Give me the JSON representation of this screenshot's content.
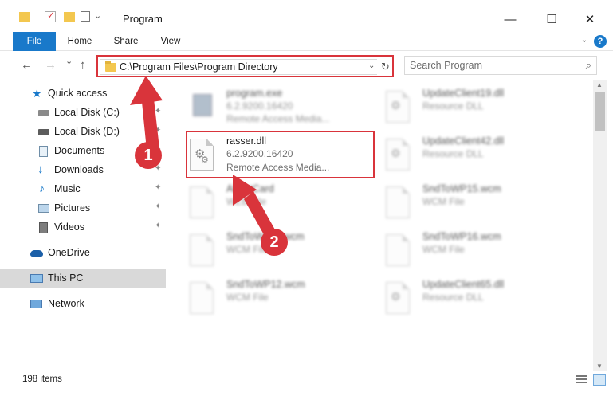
{
  "window": {
    "title": "Program",
    "minimize_glyph": "—",
    "maximize_glyph": "☐",
    "close_glyph": "✕"
  },
  "ribbon": {
    "tabs": [
      "File",
      "Home",
      "Share",
      "View"
    ],
    "help_glyph": "?",
    "collapse_glyph": "⌄"
  },
  "nav": {
    "back_glyph": "←",
    "forward_glyph": "→",
    "recent_glyph": "⌄",
    "up_glyph": "↑"
  },
  "address": {
    "path": "C:\\Program Files\\Program Directory",
    "dropdown_glyph": "⌄",
    "refresh_glyph": "↻"
  },
  "search": {
    "placeholder": "Search Program",
    "icon_glyph": "⌕"
  },
  "sidebar": {
    "items": [
      {
        "label": "Quick access",
        "icon": "star-icon",
        "pinned": false
      },
      {
        "label": "Local Disk (C:)",
        "icon": "drive-icon",
        "pinned": true
      },
      {
        "label": "Local Disk (D:)",
        "icon": "drive-icon",
        "pinned": true
      },
      {
        "label": "Documents",
        "icon": "documents-icon",
        "pinned": true
      },
      {
        "label": "Downloads",
        "icon": "download-icon",
        "pinned": true
      },
      {
        "label": "Music",
        "icon": "music-icon",
        "pinned": true
      },
      {
        "label": "Pictures",
        "icon": "pictures-icon",
        "pinned": true
      },
      {
        "label": "Videos",
        "icon": "videos-icon",
        "pinned": true
      },
      {
        "label": "OneDrive",
        "icon": "cloud-icon",
        "pinned": false
      },
      {
        "label": "This PC",
        "icon": "computer-icon",
        "pinned": false,
        "selected": true
      },
      {
        "label": "Network",
        "icon": "network-icon",
        "pinned": false
      }
    ],
    "pin_glyph": "📌"
  },
  "files": {
    "left": [
      {
        "name": "program.exe",
        "line1": "6.2.9200.16420",
        "line2": "Remote Access Media...",
        "icon": "exe-icon",
        "blurred": true
      },
      {
        "name": "rasser.dll",
        "line1": "6.2.9200.16420",
        "line2": "Remote Access Media...",
        "icon": "dll-gear-icon",
        "blurred": false,
        "highlighted": true
      },
      {
        "name": "AboutCard",
        "line1": "WEB File",
        "line2": "",
        "icon": "document-icon",
        "blurred": true
      },
      {
        "name": "SndToWP11.wcm",
        "line1": "WCM File",
        "line2": "",
        "icon": "document-icon",
        "blurred": true
      },
      {
        "name": "SndToWP12.wcm",
        "line1": "WCM File",
        "line2": "",
        "icon": "document-icon",
        "blurred": true
      }
    ],
    "right": [
      {
        "name": "UpdateClient19.dll",
        "line1": "Resource DLL",
        "line2": "",
        "icon": "dll-gear-icon",
        "blurred": true
      },
      {
        "name": "UpdateClient42.dll",
        "line1": "Resource DLL",
        "line2": "",
        "icon": "dll-gear-icon",
        "blurred": true
      },
      {
        "name": "SndToWP15.wcm",
        "line1": "WCM File",
        "line2": "",
        "icon": "document-icon",
        "blurred": true
      },
      {
        "name": "SndToWP16.wcm",
        "line1": "WCM File",
        "line2": "",
        "icon": "document-icon",
        "blurred": true
      },
      {
        "name": "UpdateClient65.dll",
        "line1": "Resource DLL",
        "line2": "",
        "icon": "dll-gear-icon",
        "blurred": true
      }
    ]
  },
  "status": {
    "item_count": "198 items"
  },
  "annotations": {
    "badge_1": "1",
    "badge_2": "2",
    "color": "#d9343b"
  },
  "colors": {
    "accent": "#1979ca",
    "annotation_red": "#d9343b",
    "selection": "#d9d9d9"
  }
}
